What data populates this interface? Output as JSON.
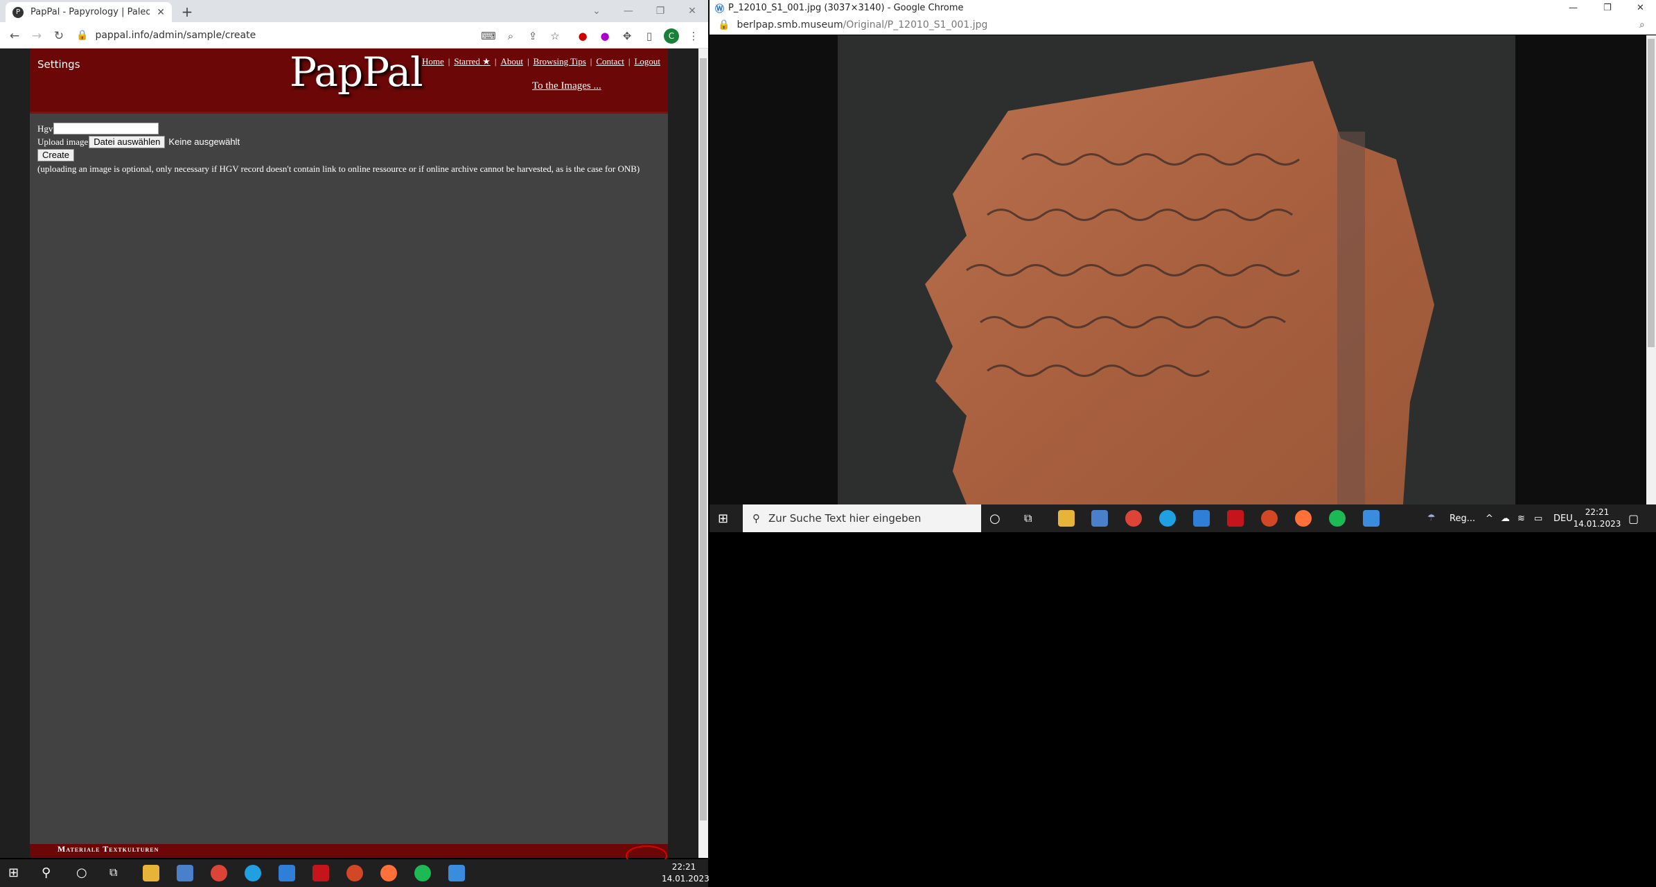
{
  "left_window": {
    "tab_title": "PapPal - Papyrology | Paleograph",
    "url": "pappal.info/admin/sample/create",
    "site": {
      "settings_label": "Settings",
      "logo_text": "PapPal",
      "nav": [
        "Home",
        "Starred ★",
        "About",
        "Browsing Tips",
        "Contact",
        "Logout"
      ],
      "images_link": "To the Images ...",
      "form": {
        "hgv_label": "Hgv",
        "upload_label": "Upload image",
        "file_button": "Datei auswählen",
        "file_status": "Keine ausgewählt",
        "create_button": "Create",
        "note": "(uploading an image is optional, only necessary if HGV record doesn't contain link to online ressource or if online archive cannot be harvested, as is the case for ONB)"
      },
      "footer_text": "Materiale Textkulturen"
    }
  },
  "right_window": {
    "title": "P_12010_S1_001.jpg (3037×3140) - Google Chrome",
    "url_domain": "berlpap.smb.museum",
    "url_path": "/Original/P_12010_S1_001.jpg"
  },
  "taskbar_right": {
    "search_placeholder": "Zur Suche Text hier eingeben",
    "weather": "Reg...",
    "language": "DEU",
    "time": "22:21",
    "date": "14.01.2023"
  },
  "taskbar_left": {
    "time": "22:21",
    "date": "14.01.2023"
  },
  "colors": {
    "site_header": "#6b0707",
    "site_body": "#424242",
    "taskbar": "#202020"
  }
}
